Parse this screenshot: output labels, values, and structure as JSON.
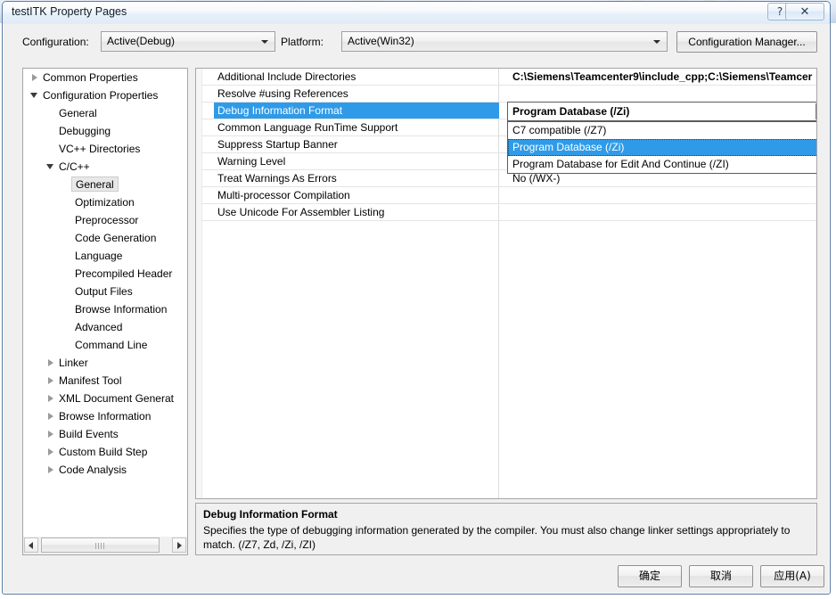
{
  "window": {
    "title": "testITK Property Pages",
    "help_glyph": "?",
    "close_glyph": "✕"
  },
  "config_bar": {
    "configuration_label": "Configuration:",
    "configuration_value": "Active(Debug)",
    "platform_label": "Platform:",
    "platform_value": "Active(Win32)",
    "config_manager_label": "Configuration Manager..."
  },
  "tree": [
    {
      "label": "Common Properties",
      "indent": 0,
      "twisty": "collapsed",
      "selected": false
    },
    {
      "label": "Configuration Properties",
      "indent": 0,
      "twisty": "expanded",
      "selected": false
    },
    {
      "label": "General",
      "indent": 1,
      "twisty": "none",
      "selected": false
    },
    {
      "label": "Debugging",
      "indent": 1,
      "twisty": "none",
      "selected": false
    },
    {
      "label": "VC++ Directories",
      "indent": 1,
      "twisty": "none",
      "selected": false
    },
    {
      "label": "C/C++",
      "indent": 1,
      "twisty": "expanded",
      "selected": false
    },
    {
      "label": "General",
      "indent": 2,
      "twisty": "none",
      "selected": true
    },
    {
      "label": "Optimization",
      "indent": 2,
      "twisty": "none",
      "selected": false
    },
    {
      "label": "Preprocessor",
      "indent": 2,
      "twisty": "none",
      "selected": false
    },
    {
      "label": "Code Generation",
      "indent": 2,
      "twisty": "none",
      "selected": false
    },
    {
      "label": "Language",
      "indent": 2,
      "twisty": "none",
      "selected": false
    },
    {
      "label": "Precompiled Header",
      "indent": 2,
      "twisty": "none",
      "selected": false
    },
    {
      "label": "Output Files",
      "indent": 2,
      "twisty": "none",
      "selected": false
    },
    {
      "label": "Browse Information",
      "indent": 2,
      "twisty": "none",
      "selected": false
    },
    {
      "label": "Advanced",
      "indent": 2,
      "twisty": "none",
      "selected": false
    },
    {
      "label": "Command Line",
      "indent": 2,
      "twisty": "none",
      "selected": false
    },
    {
      "label": "Linker",
      "indent": 1,
      "twisty": "collapsed",
      "selected": false
    },
    {
      "label": "Manifest Tool",
      "indent": 1,
      "twisty": "collapsed",
      "selected": false
    },
    {
      "label": "XML Document Generat",
      "indent": 1,
      "twisty": "collapsed",
      "selected": false
    },
    {
      "label": "Browse Information",
      "indent": 1,
      "twisty": "collapsed",
      "selected": false
    },
    {
      "label": "Build Events",
      "indent": 1,
      "twisty": "collapsed",
      "selected": false
    },
    {
      "label": "Custom Build Step",
      "indent": 1,
      "twisty": "collapsed",
      "selected": false
    },
    {
      "label": "Code Analysis",
      "indent": 1,
      "twisty": "collapsed",
      "selected": false
    }
  ],
  "grid": {
    "rows": [
      {
        "name": "Additional Include Directories",
        "value": "C:\\Siemens\\Teamcenter9\\include_cpp;C:\\Siemens\\Teamcer",
        "bold": true,
        "selected": false
      },
      {
        "name": "Resolve #using References",
        "value": "",
        "bold": false,
        "selected": false
      },
      {
        "name": "Debug Information Format",
        "value": "Program Database (/Zi)",
        "bold": true,
        "selected": true
      },
      {
        "name": "Common Language RunTime Support",
        "value": "",
        "bold": false,
        "selected": false
      },
      {
        "name": "Suppress Startup Banner",
        "value": "",
        "bold": false,
        "selected": false
      },
      {
        "name": "Warning Level",
        "value": "",
        "bold": false,
        "selected": false
      },
      {
        "name": "Treat Warnings As Errors",
        "value": "No (/WX-)",
        "bold": false,
        "selected": false
      },
      {
        "name": "Multi-processor Compilation",
        "value": "",
        "bold": false,
        "selected": false
      },
      {
        "name": "Use Unicode For Assembler Listing",
        "value": "",
        "bold": false,
        "selected": false
      }
    ]
  },
  "editor": {
    "value": "Program Database (/Zi)",
    "options": [
      {
        "label": "C7 compatible (/Z7)",
        "highlight": false
      },
      {
        "label": "Program Database (/Zi)",
        "highlight": true
      },
      {
        "label": "Program Database for Edit And Continue (/ZI)",
        "highlight": false
      }
    ]
  },
  "description": {
    "title": "Debug Information Format",
    "body": "Specifies the type of debugging information generated by the compiler.  You must also change linker settings appropriately to match.    (/Z7, Zd, /Zi, /ZI)"
  },
  "footer": {
    "ok_label": "确定",
    "cancel_label": "取消",
    "apply_label": "应用(A)"
  },
  "colors": {
    "selection_blue": "#2F9BE8",
    "dialog_face": "#F0F0F0",
    "border_gray": "#A6A6A6",
    "frame_blue": "#5B7CA3"
  }
}
